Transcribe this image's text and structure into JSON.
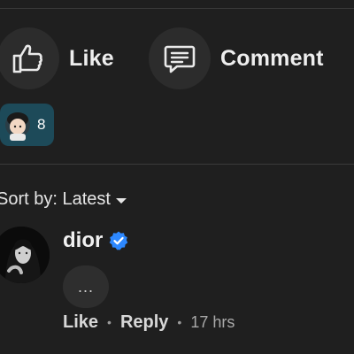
{
  "actions": {
    "like_label": "Like",
    "comment_label": "Comment"
  },
  "reactions": {
    "count": "8"
  },
  "sort": {
    "label": "Sort by: Latest"
  },
  "comment": {
    "author": "dior",
    "verified": true,
    "more_label": "...",
    "like_label": "Like",
    "reply_label": "Reply",
    "time": "17 hrs",
    "dot": "•"
  },
  "colors": {
    "background": "#1f1f1f",
    "pill": "#1d4a59",
    "verified": "#2d88ff"
  }
}
